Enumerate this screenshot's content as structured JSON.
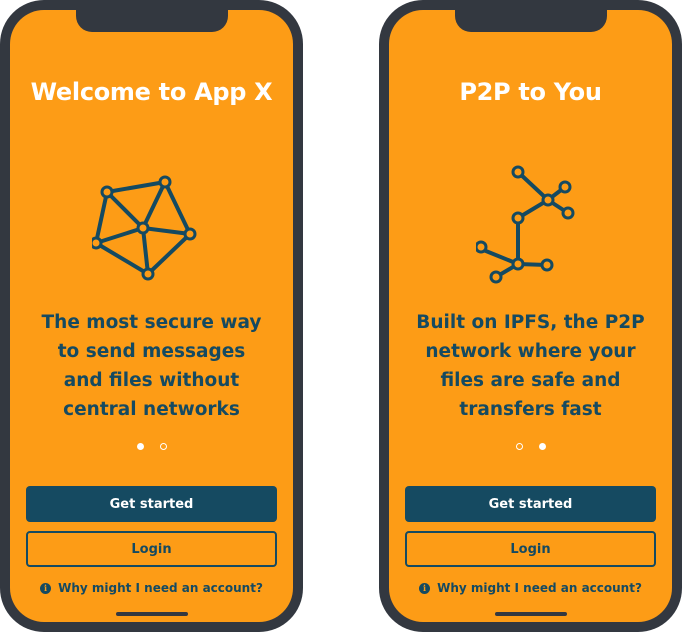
{
  "colors": {
    "accent": "#fd9c16",
    "primary": "#154a61",
    "frame": "#333840",
    "white": "#ffffff"
  },
  "screens": [
    {
      "title": "Welcome to App X",
      "illustration": "mesh-network-icon",
      "tagline": "The most secure way to send messages and files without central networks",
      "active_dot": 0,
      "primary_button": "Get started",
      "secondary_button": "Login",
      "help_text": "Why might  I need an account?"
    },
    {
      "title": "P2P to You",
      "illustration": "peer-tree-icon",
      "tagline": "Built on IPFS, the P2P network where your files are safe and transfers fast",
      "active_dot": 1,
      "primary_button": "Get started",
      "secondary_button": "Login",
      "help_text": "Why might  I need an account?"
    }
  ]
}
